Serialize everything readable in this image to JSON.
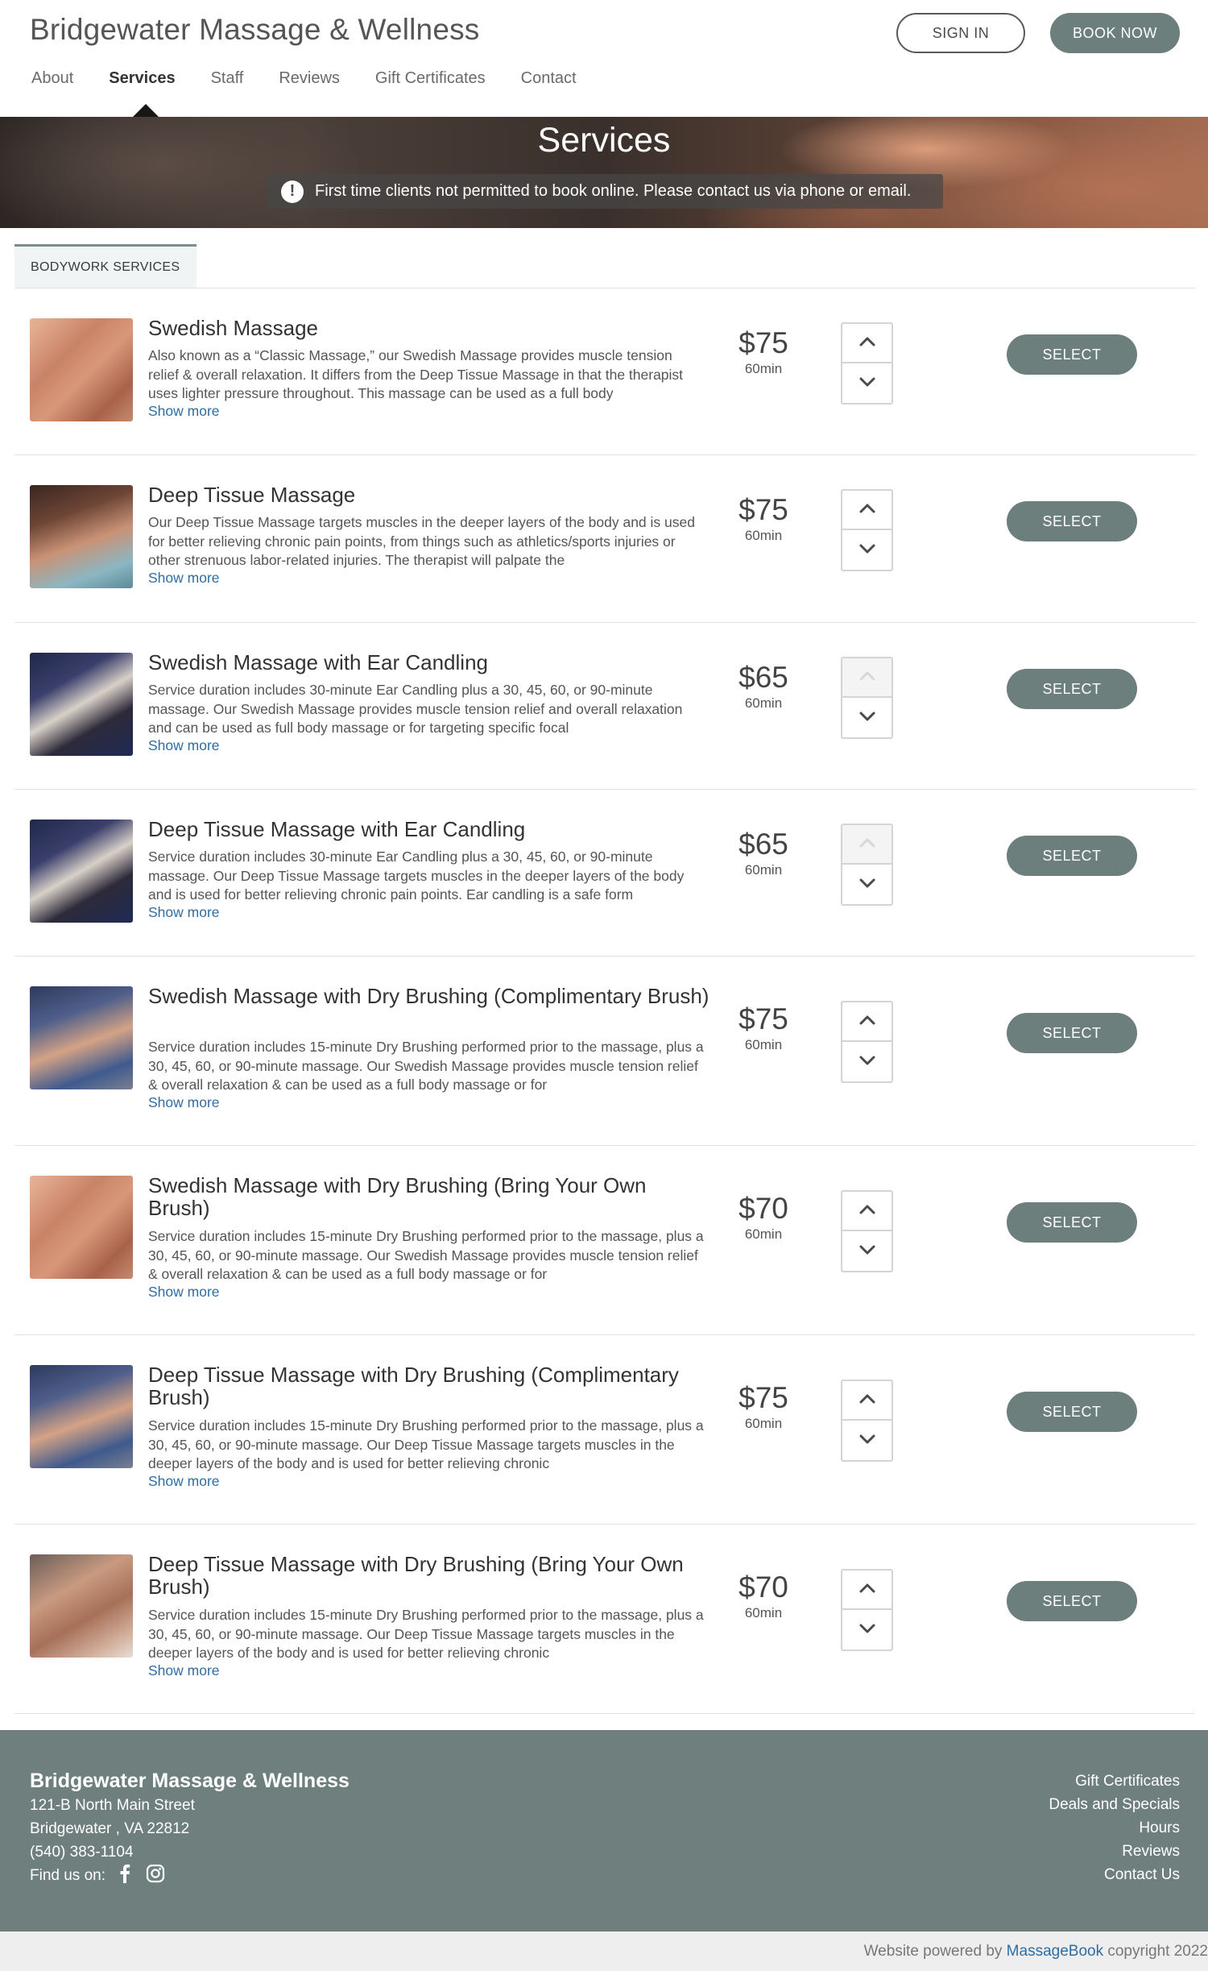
{
  "header": {
    "brand": "Bridgewater Massage & Wellness",
    "sign_in": "SIGN IN",
    "book_now": "BOOK NOW",
    "nav": [
      {
        "label": "About"
      },
      {
        "label": "Services",
        "active": true
      },
      {
        "label": "Staff"
      },
      {
        "label": "Reviews"
      },
      {
        "label": "Gift Certificates"
      },
      {
        "label": "Contact"
      }
    ]
  },
  "hero": {
    "title": "Services",
    "alert_icon": "exclamation-circle-icon",
    "alert": "First time clients not permitted to book online. Please contact us via phone or email."
  },
  "tabs": [
    "BODYWORK SERVICES"
  ],
  "services": [
    {
      "name": "Swedish Massage",
      "desc": "Also known as a “Classic Massage,” our Swedish Massage provides muscle tension relief & overall relaxation. It differs from the Deep Tissue Massage in that the therapist uses lighter pressure throughout. This massage can be used as a full body",
      "more": "Show more",
      "price": "$75",
      "duration": "60min",
      "up_disabled": false,
      "select": "SELECT",
      "image": "hands-on-back"
    },
    {
      "name": "Deep Tissue Massage",
      "desc": "Our Deep Tissue Massage targets muscles in the deeper layers of the body and is used for better relieving chronic pain points, from things such as athletics/sports injuries or other strenuous labor-related injuries. The therapist will palpate the",
      "more": "Show more",
      "price": "$75",
      "duration": "60min",
      "up_disabled": false,
      "select": "SELECT",
      "image": "shoulder-massage"
    },
    {
      "name": "Swedish Massage with Ear Candling",
      "desc": "Service duration includes 30-minute Ear Candling plus a 30, 45, 60, or 90-minute massage. Our Swedish Massage provides muscle tension relief and overall relaxation and can be used as full body massage or for targeting specific focal",
      "more": "Show more",
      "price": "$65",
      "duration": "60min",
      "up_disabled": true,
      "select": "SELECT",
      "image": "ear-candling"
    },
    {
      "name": "Deep Tissue Massage with Ear Candling",
      "desc": "Service duration includes 30-minute Ear Candling plus a 30, 45, 60, or 90-minute massage. Our Deep Tissue Massage targets muscles in the deeper layers of the body and is used for better relieving chronic pain points. Ear candling is a safe form",
      "more": "Show more",
      "price": "$65",
      "duration": "60min",
      "up_disabled": true,
      "select": "SELECT",
      "image": "ear-candling"
    },
    {
      "name": "Swedish Massage with Dry Brushing (Complimentary Brush)",
      "desc": "Service duration includes 15-minute Dry Brushing performed prior to the massage, plus a 30, 45, 60, or 90-minute massage. Our Swedish Massage provides muscle tension relief & overall relaxation & can be used as a full body massage or for",
      "more": "Show more",
      "price": "$75",
      "duration": "60min",
      "up_disabled": false,
      "select": "SELECT",
      "image": "dry-brushing"
    },
    {
      "name": "Swedish Massage with Dry Brushing (Bring Your Own Brush)",
      "desc": "Service duration includes 15-minute Dry Brushing performed prior to the massage, plus a 30, 45, 60, or 90-minute massage. Our Swedish Massage provides muscle tension relief & overall relaxation & can be used as a full body massage or for",
      "more": "Show more",
      "price": "$70",
      "duration": "60min",
      "up_disabled": false,
      "select": "SELECT",
      "image": "hands-on-back"
    },
    {
      "name": "Deep Tissue Massage with Dry Brushing (Complimentary Brush)",
      "desc": "Service duration includes 15-minute Dry Brushing performed prior to the massage, plus a 30, 45, 60, or 90-minute massage. Our Deep Tissue Massage targets muscles in the deeper layers of the body and is used for better relieving chronic",
      "more": "Show more",
      "price": "$75",
      "duration": "60min",
      "up_disabled": false,
      "select": "SELECT",
      "image": "dry-brushing"
    },
    {
      "name": "Deep Tissue Massage with Dry Brushing (Bring Your Own Brush)",
      "desc": "Service duration includes 15-minute Dry Brushing performed prior to the massage, plus a 30, 45, 60, or 90-minute massage. Our Deep Tissue Massage targets muscles in the deeper layers of the body and is used for better relieving chronic",
      "more": "Show more",
      "price": "$70",
      "duration": "60min",
      "up_disabled": false,
      "select": "SELECT",
      "image": "back-massage"
    }
  ],
  "footer": {
    "name": "Bridgewater Massage & Wellness",
    "address1": "121-B North Main Street",
    "address2": "Bridgewater , VA 22812",
    "phone": "(540) 383-1104",
    "find_us": "Find us on:",
    "social_icons": [
      "facebook-icon",
      "instagram-icon"
    ],
    "links": [
      "Gift Certificates",
      "Deals and Specials",
      "Hours",
      "Reviews",
      "Contact Us"
    ]
  },
  "subfooter": {
    "prefix": "Website powered by ",
    "brand": "MassageBook",
    "suffix": " copyright 2022"
  },
  "colors": {
    "accent": "#6d7f7d",
    "link": "#2e6da4"
  }
}
